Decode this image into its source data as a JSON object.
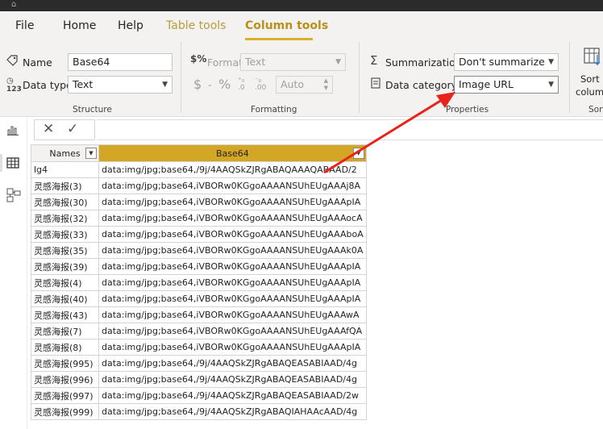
{
  "menu": {
    "file": "File",
    "home": "Home",
    "help": "Help",
    "table_tools": "Table tools",
    "column_tools": "Column tools"
  },
  "structure": {
    "name_label": "Name",
    "name_value": "Base64",
    "data_type_label": "Data type",
    "data_type_value": "Text",
    "group_label": "Structure"
  },
  "formatting": {
    "format_label": "Format",
    "format_value": "Text",
    "currency_symbol": "$",
    "percent_symbol": "%",
    "decimal_value": "Auto",
    "group_label": "Formatting"
  },
  "properties": {
    "summarization_label": "Summarization",
    "summarization_value": "Don't summarize",
    "data_category_label": "Data category",
    "data_category_value": "Image URL",
    "group_label": "Properties"
  },
  "sort": {
    "label_line1": "Sort b",
    "label_line2": "colum",
    "group_label": "Sort"
  },
  "table": {
    "headers": [
      "Names",
      "Base64"
    ],
    "rows": [
      [
        "lg4",
        "data:img/jpg;base64,/9j/4AAQSkZJRgABAQAAAQABAAD/2"
      ],
      [
        "灵感海报(3)",
        "data:img/jpg;base64,iVBORw0KGgoAAAANSUhEUgAAAj8A"
      ],
      [
        "灵感海报(30)",
        "data:img/jpg;base64,iVBORw0KGgoAAAANSUhEUgAAApIA"
      ],
      [
        "灵感海报(32)",
        "data:img/jpg;base64,iVBORw0KGgoAAAANSUhEUgAAAocA"
      ],
      [
        "灵感海报(33)",
        "data:img/jpg;base64,iVBORw0KGgoAAAANSUhEUgAAAboA"
      ],
      [
        "灵感海报(35)",
        "data:img/jpg;base64,iVBORw0KGgoAAAANSUhEUgAAAk0A"
      ],
      [
        "灵感海报(39)",
        "data:img/jpg;base64,iVBORw0KGgoAAAANSUhEUgAAApIA"
      ],
      [
        "灵感海报(4)",
        "data:img/jpg;base64,iVBORw0KGgoAAAANSUhEUgAAApIA"
      ],
      [
        "灵感海报(40)",
        "data:img/jpg;base64,iVBORw0KGgoAAAANSUhEUgAAApIA"
      ],
      [
        "灵感海报(43)",
        "data:img/jpg;base64,iVBORw0KGgoAAAANSUhEUgAAAwA"
      ],
      [
        "灵感海报(7)",
        "data:img/jpg;base64,iVBORw0KGgoAAAANSUhEUgAAAfQA"
      ],
      [
        "灵感海报(8)",
        "data:img/jpg;base64,iVBORw0KGgoAAAANSUhEUgAAApIA"
      ],
      [
        "灵感海报(995)",
        "data:img/jpg;base64,/9j/4AAQSkZJRgABAQEASABIAAD/4g"
      ],
      [
        "灵感海报(996)",
        "data:img/jpg;base64,/9j/4AAQSkZJRgABAQEASABIAAD/4g"
      ],
      [
        "灵感海报(997)",
        "data:img/jpg;base64,/9j/4AAQSkZJRgABAQEASABIAAD/2w"
      ],
      [
        "灵感海报(999)",
        "data:img/jpg;base64,/9j/4AAQSkZJRgABAQIAHAAcAAD/4g"
      ]
    ]
  },
  "icons": {
    "app": "app-icon",
    "report_view": "bar-chart-icon",
    "data_view": "table-icon",
    "model_view": "model-icon",
    "cancel": "close-icon",
    "commit": "check-icon"
  },
  "colors": {
    "accent": "#d4a625",
    "arrow": "#e8231b"
  }
}
